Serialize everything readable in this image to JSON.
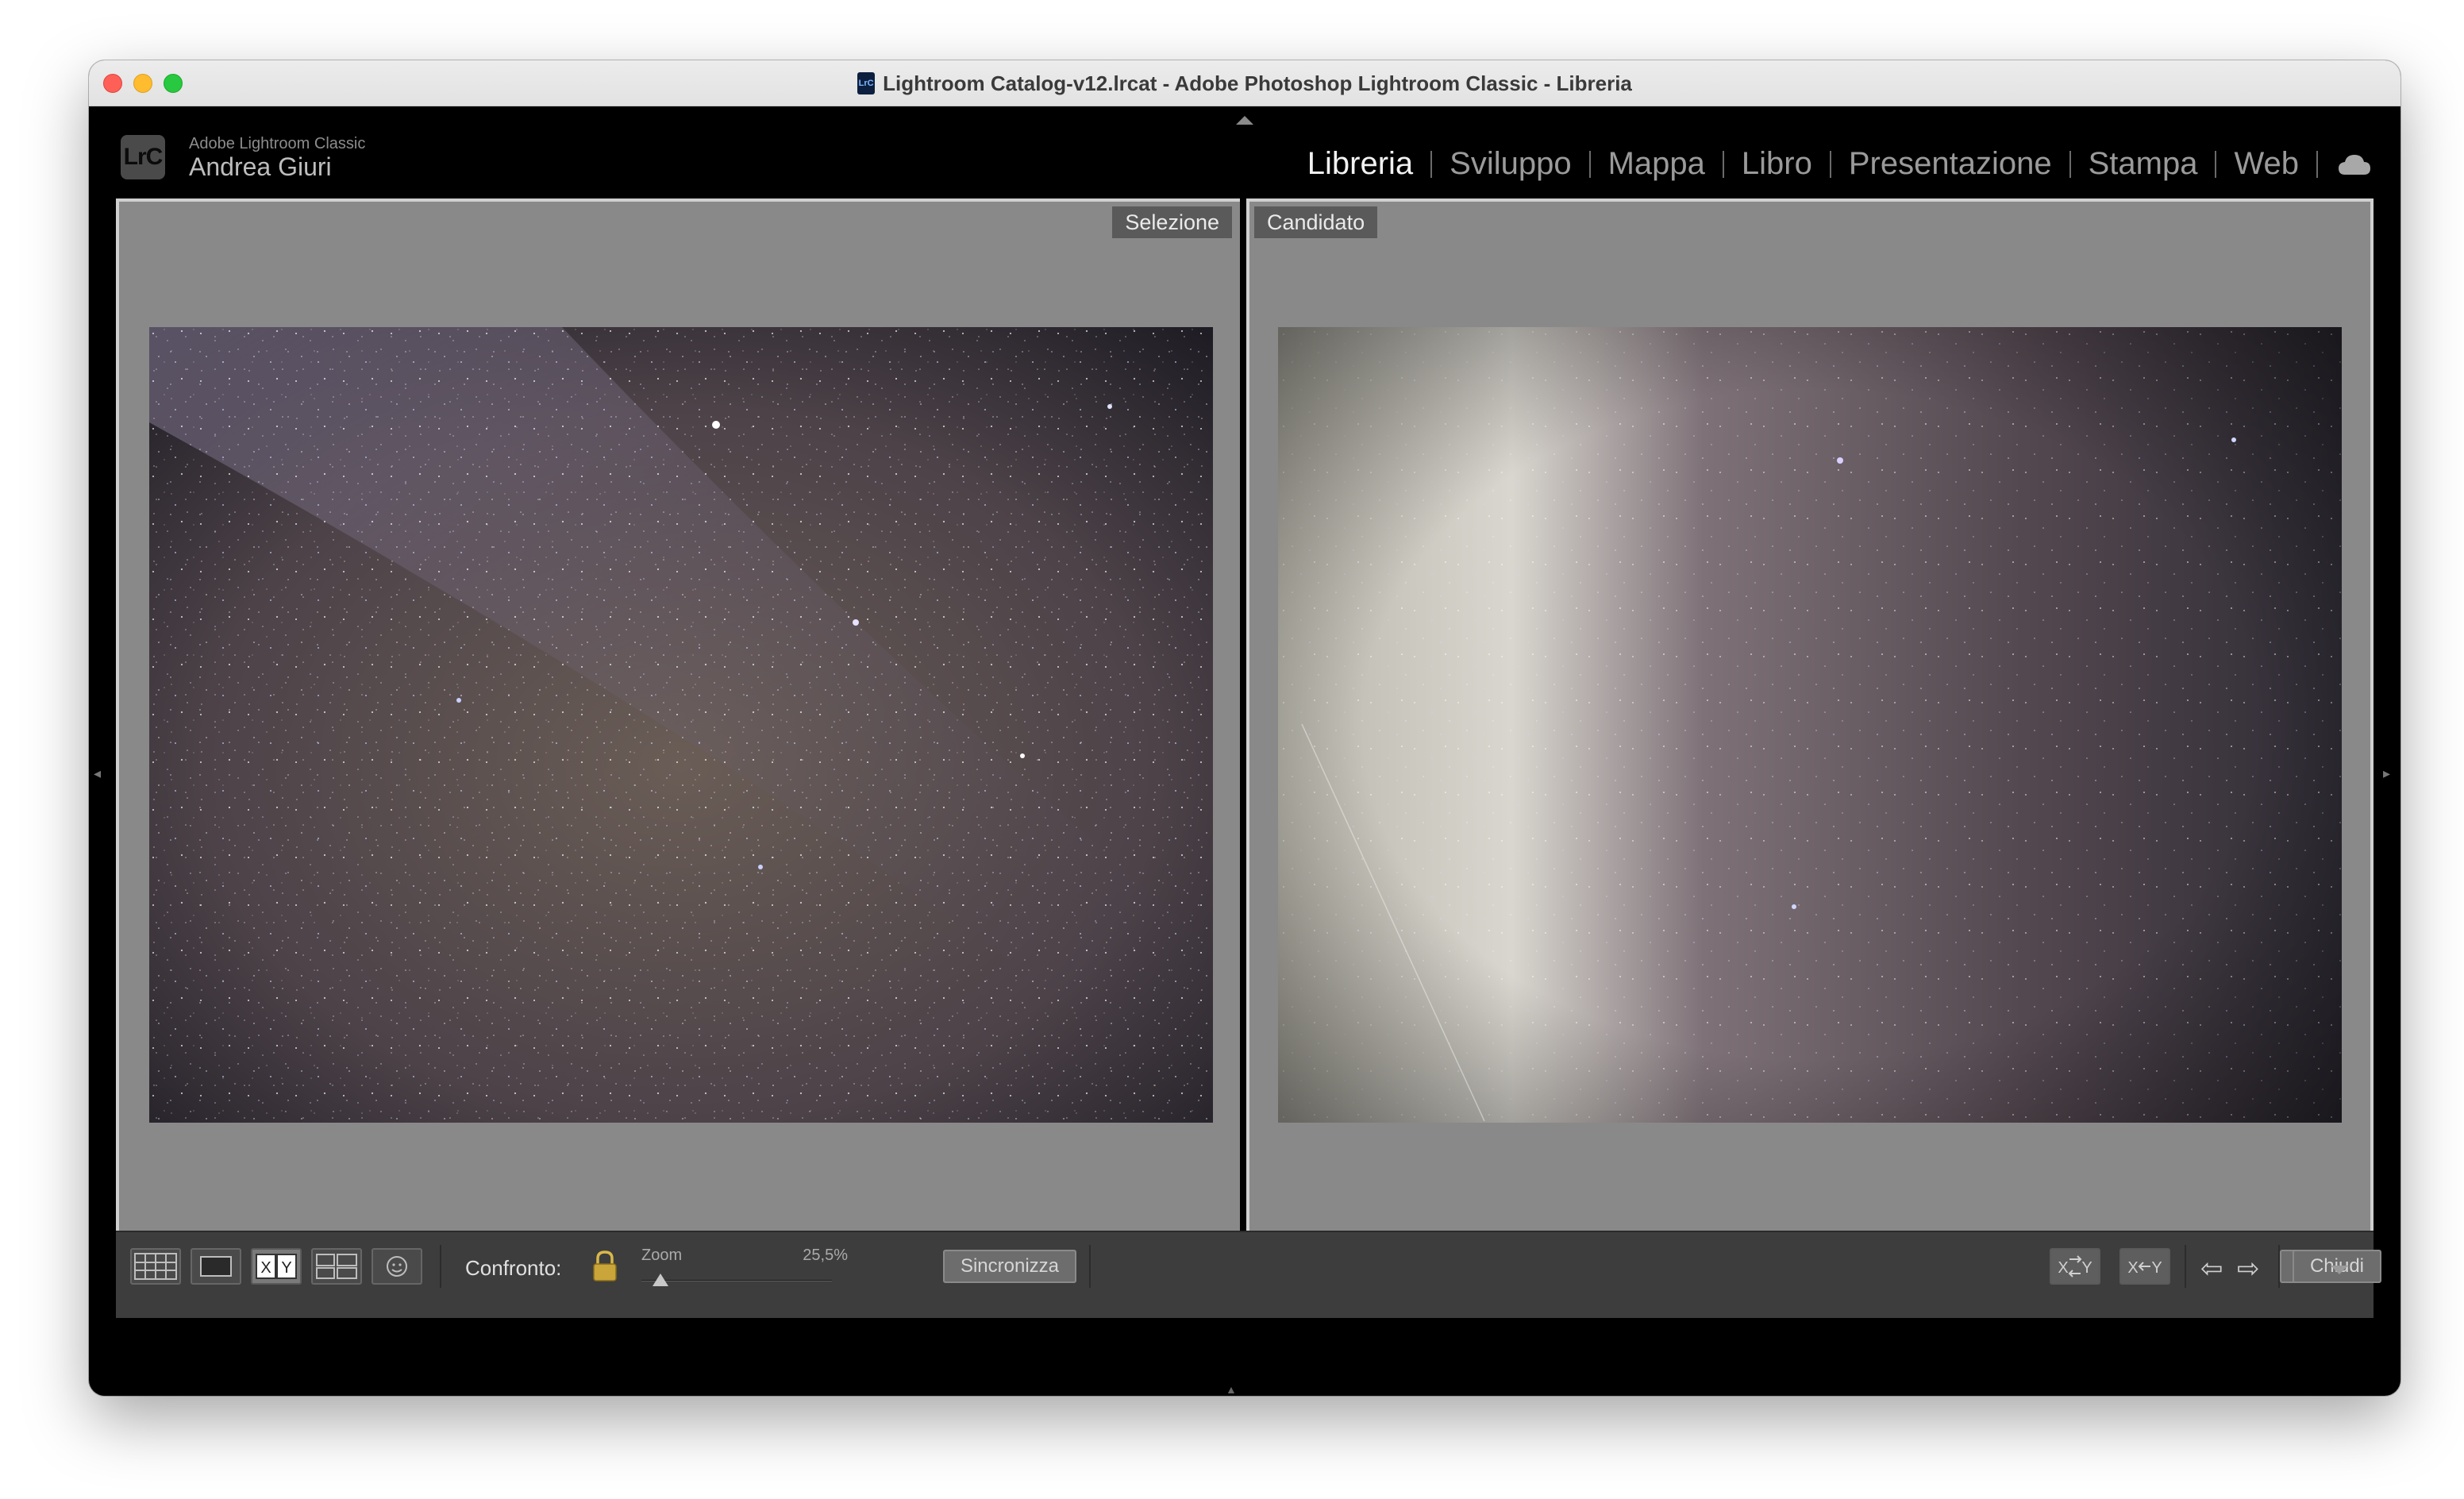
{
  "window": {
    "title": "Lightroom Catalog-v12.lrcat - Adobe Photoshop Lightroom Classic - Libreria",
    "doc_icon_text": "LrC"
  },
  "identity": {
    "logo": "LrC",
    "app_name": "Adobe Lightroom Classic",
    "user_name": "Andrea Giuri"
  },
  "modules": [
    {
      "label": "Libreria",
      "active": true
    },
    {
      "label": "Sviluppo",
      "active": false
    },
    {
      "label": "Mappa",
      "active": false
    },
    {
      "label": "Libro",
      "active": false
    },
    {
      "label": "Presentazione",
      "active": false
    },
    {
      "label": "Stampa",
      "active": false
    },
    {
      "label": "Web",
      "active": false
    }
  ],
  "compare": {
    "select_label": "Selezione",
    "candidate_label": "Candidato"
  },
  "pane_toolbar": {
    "rating_dots": "• • • • •",
    "close_glyph": "✕"
  },
  "toolbar": {
    "compare_label": "Confronto:",
    "zoom_label": "Zoom",
    "zoom_value": "25,5%",
    "zoom_level_fraction": 0.1,
    "sync_label": "Sincronizza",
    "close_label": "Chiudi",
    "prev_glyph": "⇦",
    "next_glyph": "⇨"
  },
  "icons": {
    "grid": "grid-view-icon",
    "loupe": "loupe-view-icon",
    "compare": "compare-view-icon",
    "survey": "survey-view-icon",
    "people": "people-view-icon",
    "lock": "lock-icon",
    "cloud": "cloud-icon"
  },
  "colors": {
    "pane_background": "#898989",
    "active_module": "#f2f2f2",
    "inactive_module": "#9a9a9a",
    "toolbar": "#3d3d3d"
  }
}
